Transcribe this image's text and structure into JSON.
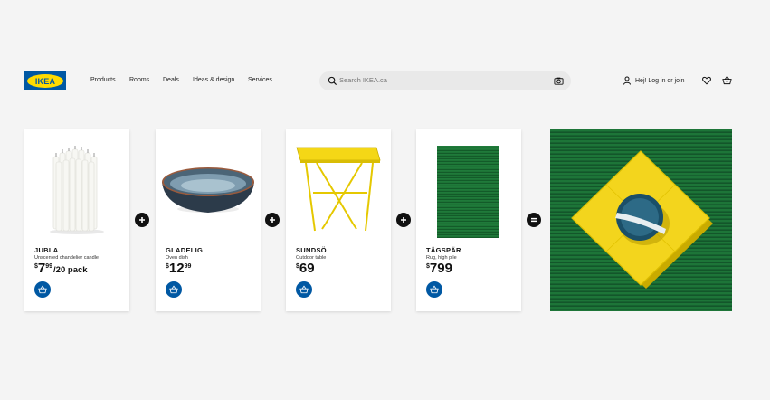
{
  "brand": {
    "logo_text": "IKEA",
    "blue": "#0058a3",
    "yellow": "#ffdb00"
  },
  "nav": [
    "Products",
    "Rooms",
    "Deals",
    "Ideas & design",
    "Services"
  ],
  "search": {
    "placeholder": "Search IKEA.ca",
    "icon": "search-icon",
    "camera_icon": "camera-icon"
  },
  "account": {
    "label": "Hej! Log in or join",
    "icon": "user-icon"
  },
  "icons": {
    "wishlist": "heart-icon",
    "cart": "shopping-basket-icon"
  },
  "products": [
    {
      "name": "JUBLA",
      "desc": "Unscented chandelier candle",
      "currency": "$",
      "whole": "7",
      "cents": "99",
      "unit": "/20 pack"
    },
    {
      "name": "GLADELIG",
      "desc": "Oven dish",
      "currency": "$",
      "whole": "12",
      "cents": "99",
      "unit": ""
    },
    {
      "name": "SUNDSÖ",
      "desc": "Outdoor table",
      "currency": "$",
      "whole": "69",
      "cents": "",
      "unit": ""
    },
    {
      "name": "TÅGSPÄR",
      "desc": "Rug, high pile",
      "currency": "$",
      "whole": "799",
      "cents": "",
      "unit": ""
    }
  ],
  "operators": [
    "+",
    "+",
    "+",
    "="
  ]
}
